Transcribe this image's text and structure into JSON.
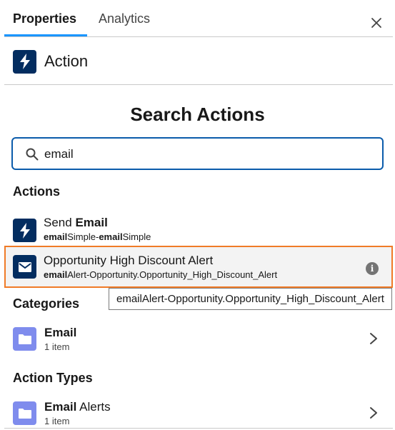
{
  "tabs": [
    {
      "label": "Properties",
      "active": true
    },
    {
      "label": "Analytics",
      "active": false
    }
  ],
  "header": {
    "title": "Action",
    "icon": "lightning-icon"
  },
  "search": {
    "title": "Search Actions",
    "value": "email",
    "placeholder": ""
  },
  "sections": {
    "actions": "Actions",
    "categories": "Categories",
    "action_types": "Action Types"
  },
  "actions": [
    {
      "title_pre": "Send ",
      "title_bold": "Email",
      "sub_b1": "email",
      "sub_t1": "Simple-",
      "sub_b2": "email",
      "sub_t2": "Simple",
      "icon": "lightning-icon"
    },
    {
      "title_pre": "Opportunity High Discount Alert",
      "title_bold": "",
      "sub_b1": "email",
      "sub_t1": "Alert-Opportunity.Opportunity_High_Discount_Alert",
      "sub_b2": "",
      "sub_t2": "",
      "icon": "envelope-icon",
      "selected": true
    }
  ],
  "tooltip": "emailAlert-Opportunity.Opportunity_High_Discount_Alert",
  "categories": [
    {
      "title_bold": "Email",
      "title_rest": "",
      "count": "1 item",
      "icon": "folder-icon"
    }
  ],
  "action_types": [
    {
      "title_bold": "Email",
      "title_rest": " Alerts",
      "count": "1 item",
      "icon": "folder-icon"
    }
  ],
  "colors": {
    "accent": "#1b96ff",
    "icon_dark": "#032d60",
    "folder": "#7f8ced",
    "selected_border": "#f07b27",
    "search_border": "#0b5cab"
  }
}
